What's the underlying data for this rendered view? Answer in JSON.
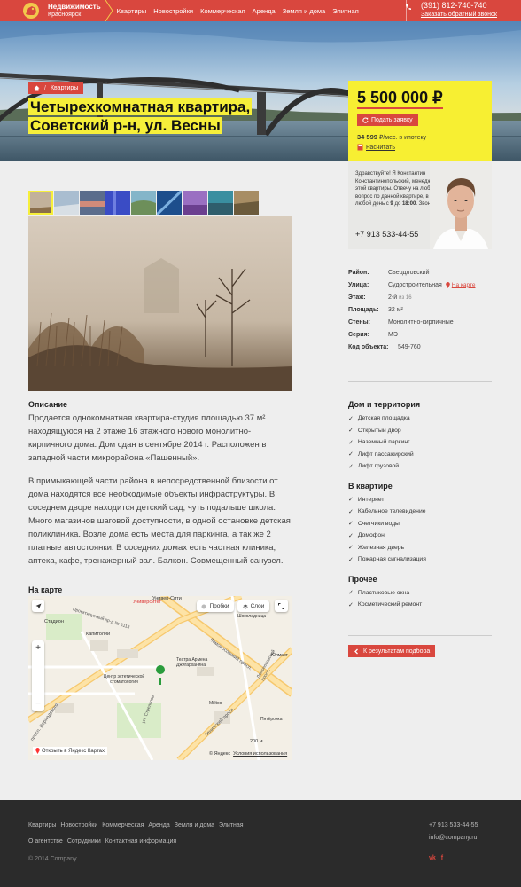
{
  "header": {
    "brand": "Недвижимость",
    "city": "Красноярск",
    "nav": [
      "Квартиры",
      "Новостройки",
      "Коммерческая",
      "Аренда",
      "Земля и дома",
      "Элитная"
    ],
    "phone": "(391) 812-740-740",
    "callback": "Заказать обратный звонок"
  },
  "breadcrumb": {
    "item": "Квартиры"
  },
  "title": {
    "line1": "Четырехкомнатная квартира,",
    "line2": "Советский р-н, ул. Весны"
  },
  "price": {
    "value": "5 500 000 ₽",
    "request_button": "Подать заявку",
    "mortgage_amount": "34 599",
    "mortgage_text": "₽/мес. в ипотеку",
    "calc_link": "Расчитать"
  },
  "manager": {
    "text": "Здравствуйте! Я Константин Константинопольский, менеджер этой квартиры. Отвечу на любой вопрос по данной квартире, в любой день с",
    "hours_from": "9",
    "hours_mid": "до",
    "hours_to": "18:00",
    "hours_end": ". Звоните!",
    "phone": "+7 913 533-44-55"
  },
  "properties": [
    {
      "label": "Район:",
      "value": "Свердловский"
    },
    {
      "label": "Улица:",
      "value": "Судостроительная",
      "link": "На карте"
    },
    {
      "label": "Этаж:",
      "value": "2-й",
      "extra": "из 16"
    },
    {
      "label": "Площадь:",
      "value": "32 м²"
    },
    {
      "label": "Стены:",
      "value": "Монолитно-кирпичные"
    },
    {
      "label": "Серия:",
      "value": "МЭ"
    },
    {
      "label": "Код объекта:",
      "value": "549-760"
    }
  ],
  "description": {
    "title": "Описание",
    "p1": "Продается однокомнатная квартира-студия площадью 37 м² находящуюся на 2 этаже 16 этажного нового монолитно-кирпичного дома. Дом сдан в сентябре 2014 г. Расположен в западной части микрорайона «Пашенный».",
    "p2": "В примыкающей части района в непосредственной близости от дома находятся все необходимые объекты инфраструктуры. В соседнем дворе находится детский сад, чуть подальше школа. Много магазинов шаговой доступности, в одной остановке детская поликлиника. Возле дома есть места для паркинга, а так же 2 платные автостоянки. В соседних домах есть частная клиника, аптека, кафе, тренажерный зал. Балкон. Совмещенный санузел."
  },
  "features": [
    {
      "title": "Дом и территория",
      "items": [
        "Детская площадка",
        "Открытый двор",
        "Наземный паркинг",
        "Лифт пассажирский",
        "Лифт грузовой"
      ]
    },
    {
      "title": "В квартире",
      "items": [
        "Интернет",
        "Кабельное телевидение",
        "Счетчики воды",
        "Домофон",
        "Железная дверь",
        "Пожарная сигнализация"
      ]
    },
    {
      "title": "Прочее",
      "items": [
        "Пластиковые окна",
        "Косметический ремонт"
      ]
    }
  ],
  "back_button": "К результатам подбора",
  "map": {
    "title": "На карте",
    "traffic": "Пробки",
    "layers": "Слои",
    "open_link": "Открыть в Яндекс Картах",
    "scale": "200 м",
    "copyright": "© Яндекс",
    "terms": "Условия использования",
    "labels": {
      "metro": "Университет",
      "uni_city": "Универ-Сити",
      "stadium": "Стадион",
      "capitol": "Капитолий",
      "proezd": "Проектируемый пр-д № 6113",
      "clinic": "Центр эстетической стоматологии",
      "theatre": "Театра Армена Джигарханяна",
      "lomonosov": "Ломоносовский просп.",
      "lenin": "Ленинский просп.",
      "vernadsky": "просп. Вернадского",
      "strelkova": "ул. Стрелкова",
      "lomonosov2": "Ломоносовский просп.",
      "mikroc": "Milltoo",
      "pyat": "Пятёрочка",
      "shop1": "Шоколадница",
      "shop2": "Юлмарт"
    }
  },
  "footer": {
    "nav1": [
      "Квартиры",
      "Новостройки",
      "Коммерческая",
      "Аренда",
      "Земля и дома",
      "Элитная"
    ],
    "nav2": [
      "О агентстве",
      "Сотрудники",
      "Контактная информация"
    ],
    "phone": "+7 913 533-44-55",
    "email": "info@company.ru",
    "copyright": "© 2014 Company"
  },
  "colors": {
    "accent": "#d9473e",
    "yellow": "#f7ef32",
    "footer": "#2b2b2b"
  }
}
